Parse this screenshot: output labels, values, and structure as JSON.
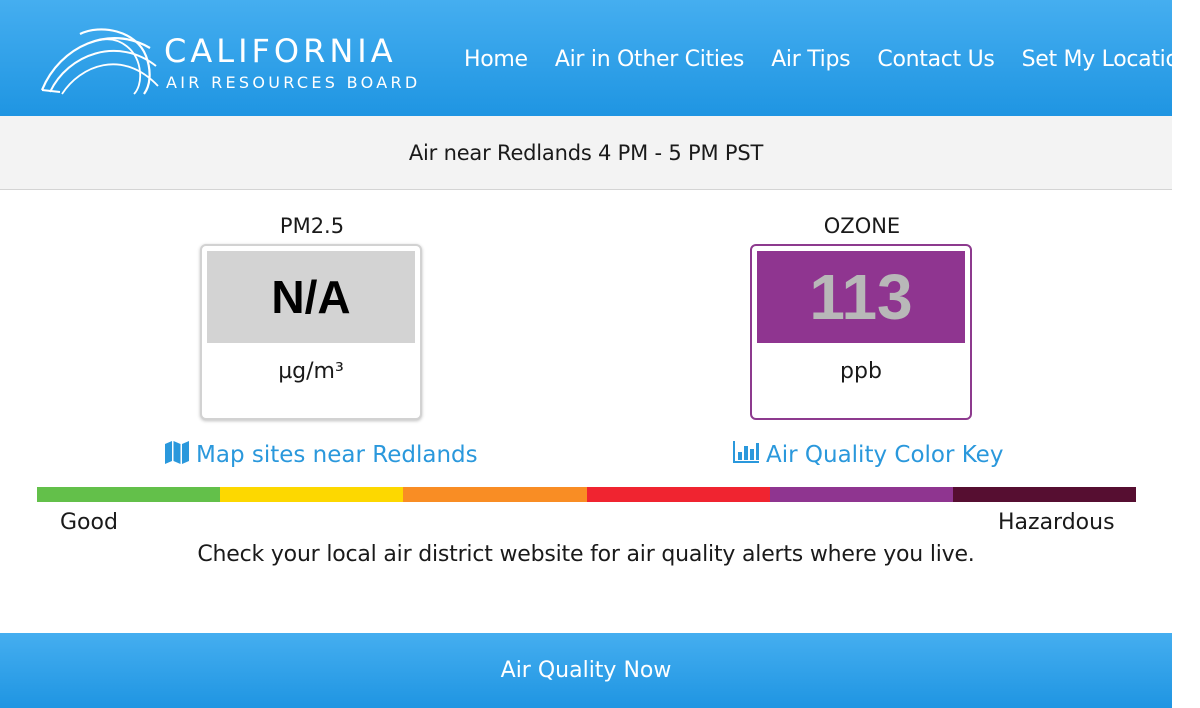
{
  "header": {
    "logo_title": "CALIFORNIA",
    "logo_subtitle": "AIR RESOURCES BOARD",
    "nav": [
      "Home",
      "Air in Other Cities",
      "Air Tips",
      "Contact Us",
      "Set My Location"
    ]
  },
  "subheader": {
    "text": "Air near Redlands 4 PM - 5 PM PST"
  },
  "pm25": {
    "label": "PM2.5",
    "value": "N/A",
    "unit": "µg/m³"
  },
  "ozone": {
    "label": "OZONE",
    "value": "113",
    "unit": "ppb"
  },
  "links": {
    "map_sites": "Map sites near Redlands",
    "color_key": "Air Quality Color Key"
  },
  "scale": {
    "colors": [
      "#63c04a",
      "#fdd800",
      "#f98d24",
      "#f02430",
      "#8f3590",
      "#560e31"
    ],
    "low_label": "Good",
    "high_label": "Hazardous"
  },
  "notice": "Check your local air district website for air quality alerts where you live.",
  "footer": {
    "text": "Air Quality Now"
  },
  "colors": {
    "brand_blue": "#2a98dc",
    "pm_bg": "#d3d3d3",
    "ozone_bg": "#8f3590"
  },
  "icons": {
    "logo": "arc-swoosh-logo",
    "map_link": "map-icon",
    "key_link": "bar-chart-icon"
  }
}
